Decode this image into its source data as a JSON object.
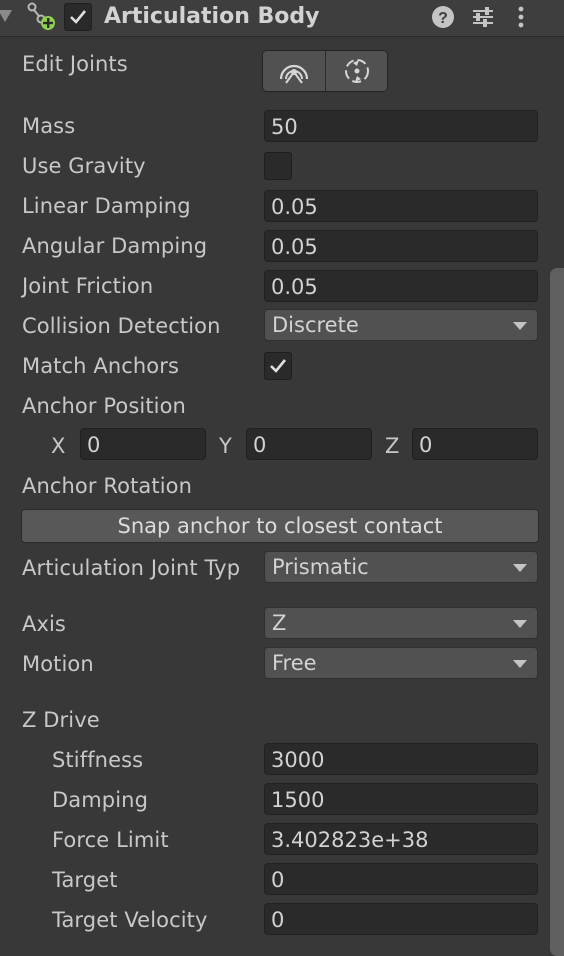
{
  "component": {
    "title": "Articulation Body",
    "enabled": true
  },
  "edit_joints": {
    "label": "Edit Joints"
  },
  "mass": {
    "label": "Mass",
    "value": "50"
  },
  "use_gravity": {
    "label": "Use Gravity",
    "checked": false
  },
  "linear_damping": {
    "label": "Linear Damping",
    "value": "0.05"
  },
  "angular_damping": {
    "label": "Angular Damping",
    "value": "0.05"
  },
  "joint_friction": {
    "label": "Joint Friction",
    "value": "0.05"
  },
  "collision_detection": {
    "label": "Collision Detection",
    "value": "Discrete"
  },
  "match_anchors": {
    "label": "Match Anchors",
    "checked": true
  },
  "anchor_position": {
    "label": "Anchor Position",
    "x_label": "X",
    "x": "0",
    "y_label": "Y",
    "y": "0",
    "z_label": "Z",
    "z": "0"
  },
  "anchor_rotation": {
    "label": "Anchor Rotation"
  },
  "snap_button": {
    "label": "Snap anchor to closest contact"
  },
  "joint_type": {
    "label": "Articulation Joint Typ",
    "value": "Prismatic"
  },
  "axis": {
    "label": "Axis",
    "value": "Z"
  },
  "motion": {
    "label": "Motion",
    "value": "Free"
  },
  "z_drive": {
    "label": "Z Drive",
    "stiffness_label": "Stiffness",
    "stiffness": "3000",
    "damping_label": "Damping",
    "damping": "1500",
    "force_limit_label": "Force Limit",
    "force_limit": "3.402823e+38",
    "target_label": "Target",
    "target": "0",
    "target_velocity_label": "Target Velocity",
    "target_velocity": "0"
  },
  "icons": {
    "component": "articulation-body-icon",
    "help": "help-icon",
    "presets": "presets-icon",
    "menu": "kebab-menu-icon",
    "edit_anchor": "edit-anchor-icon",
    "edit_rotation": "edit-rotation-icon"
  },
  "colors": {
    "background": "#383838",
    "field": "#2a2a2a",
    "dropdown": "#515151",
    "text": "#c8c8c8",
    "icon_green": "#8fd14f"
  }
}
